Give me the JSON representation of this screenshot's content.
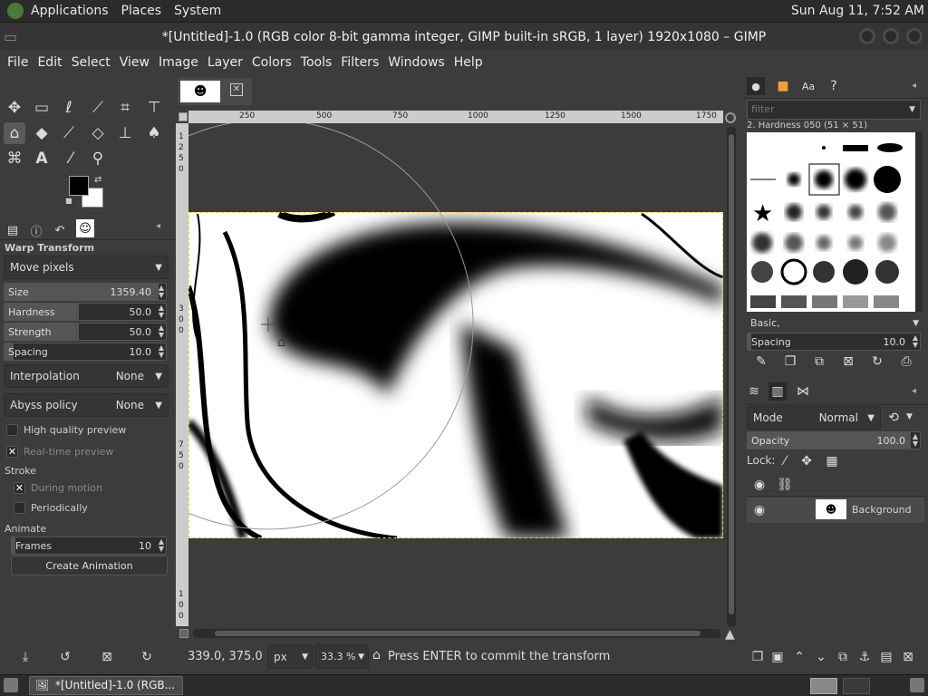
{
  "system_panel": {
    "menus": [
      "Applications",
      "Places",
      "System"
    ],
    "clock": "Sun Aug 11,  7:52 AM"
  },
  "window": {
    "title": "*[Untitled]-1.0 (RGB color 8-bit gamma integer, GIMP built-in sRGB, 1 layer) 1920x1080 – GIMP"
  },
  "menubar": [
    "File",
    "Edit",
    "Select",
    "View",
    "Image",
    "Layer",
    "Colors",
    "Tools",
    "Filters",
    "Windows",
    "Help"
  ],
  "tool_options": {
    "title": "Warp Transform",
    "mode": "Move pixels",
    "size_label": "Size",
    "size_value": "1359.40",
    "hardness_label": "Hardness",
    "hardness_value": "50.0",
    "strength_label": "Strength",
    "strength_value": "50.0",
    "spacing_label": "Spacing",
    "spacing_value": "10.0",
    "interpolation_label": "Interpolation",
    "interpolation_value": "None",
    "abyss_label": "Abyss policy",
    "abyss_value": "None",
    "high_quality_label": "High quality preview",
    "realtime_label": "Real-time preview",
    "stroke_label": "Stroke",
    "during_motion_label": "During motion",
    "periodically_label": "Periodically",
    "animate_label": "Animate",
    "frames_label": "Frames",
    "frames_value": "10",
    "create_animation_label": "Create Animation"
  },
  "rulers": {
    "h_ticks": [
      "250",
      "500",
      "750",
      "1000",
      "1250",
      "1500",
      "1750"
    ],
    "v_ticks": [
      "1",
      "2",
      "5",
      "0",
      "3",
      "0",
      "0",
      "7",
      "5",
      "0",
      "1",
      "0",
      "0",
      "0"
    ]
  },
  "status": {
    "coords": "339.0, 375.0",
    "unit": "px",
    "zoom": "33.3 %",
    "message": "Press ENTER to commit the transform"
  },
  "brushes": {
    "filter_placeholder": "filter",
    "selected": "2. Hardness 050 (51 × 51)",
    "tag": "Basic,",
    "spacing_label": "Spacing",
    "spacing_value": "10.0"
  },
  "layers": {
    "mode_label": "Mode",
    "mode_value": "Normal",
    "opacity_label": "Opacity",
    "opacity_value": "100.0",
    "lock_label": "Lock:",
    "layer_name": "Background"
  },
  "taskbar": {
    "item": "*[Untitled]-1.0 (RGB..."
  }
}
